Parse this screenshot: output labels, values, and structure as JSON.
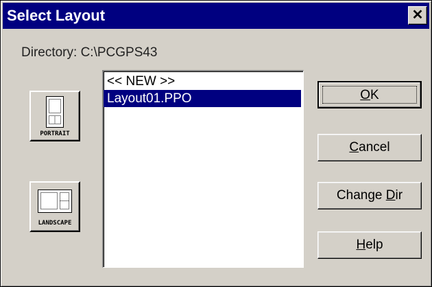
{
  "window": {
    "title": "Select Layout",
    "close_glyph": "✕"
  },
  "directory": {
    "text": "Directory: C:\\PCGPS43"
  },
  "layout_buttons": {
    "portrait": {
      "label": "PORTRAIT",
      "icon": "portrait-page-icon"
    },
    "landscape": {
      "label": "LANDSCAPE",
      "icon": "landscape-page-icon"
    }
  },
  "files": {
    "items": [
      "<< NEW >>",
      "Layout01.PPO"
    ],
    "selected_index": 1
  },
  "buttons": {
    "ok": {
      "pre": "",
      "mnemonic": "O",
      "post": "K"
    },
    "cancel": {
      "pre": "",
      "mnemonic": "C",
      "post": "ancel"
    },
    "change_dir": {
      "pre": "Change ",
      "mnemonic": "D",
      "post": "ir"
    },
    "help": {
      "pre": "",
      "mnemonic": "H",
      "post": "elp"
    }
  },
  "colors": {
    "titlebar": "#000080",
    "face": "#d4d0c8",
    "selection": "#000080"
  }
}
